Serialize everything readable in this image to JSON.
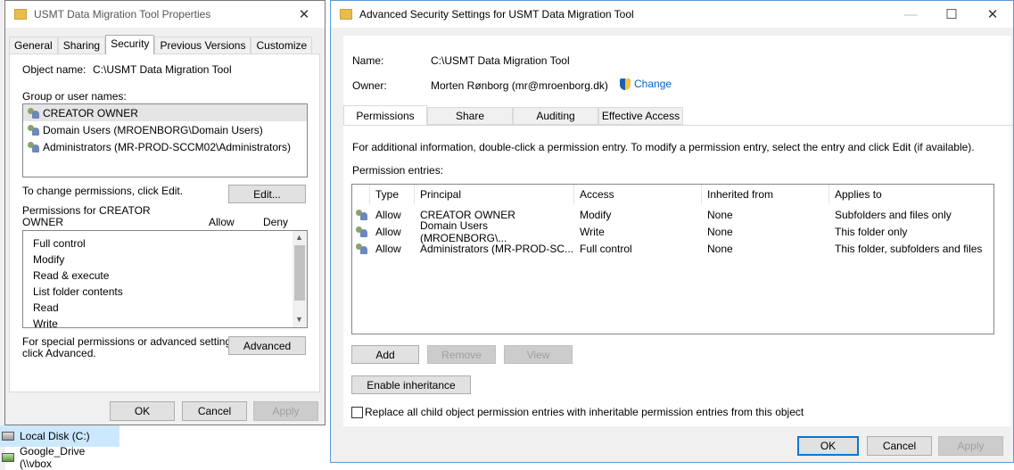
{
  "explorer": {
    "items": [
      {
        "label": "Local Disk (C:)",
        "selected": true
      },
      {
        "label": "Google_Drive (\\\\vbox",
        "selected": false
      }
    ]
  },
  "props": {
    "title": "USMT Data Migration Tool Properties",
    "tabs": [
      "General",
      "Sharing",
      "Security",
      "Previous Versions",
      "Customize"
    ],
    "active_tab": "Security",
    "object_label": "Object name:",
    "object_value": "C:\\USMT Data Migration Tool",
    "group_label": "Group or user names:",
    "groups": [
      "CREATOR OWNER",
      "Domain Users (MROENBORG\\Domain Users)",
      "Administrators (MR-PROD-SCCM02\\Administrators)"
    ],
    "change_text": "To change permissions, click Edit.",
    "edit_button": "Edit...",
    "perm_label_1": "Permissions for CREATOR",
    "perm_label_2": "OWNER",
    "allow_col": "Allow",
    "deny_col": "Deny",
    "permissions": [
      "Full control",
      "Modify",
      "Read & execute",
      "List folder contents",
      "Read",
      "Write"
    ],
    "special_text_1": "For special permissions or advanced settings,",
    "special_text_2": "click Advanced.",
    "advanced_button": "Advanced",
    "ok": "OK",
    "cancel": "Cancel",
    "apply": "Apply"
  },
  "adv": {
    "title": "Advanced Security Settings for USMT Data Migration Tool",
    "name_label": "Name:",
    "name_value": "C:\\USMT Data Migration Tool",
    "owner_label": "Owner:",
    "owner_value": "Morten Rønborg (mr@mroenborg.dk)",
    "change_link": "Change",
    "tabs": [
      "Permissions",
      "Share",
      "Auditing",
      "Effective Access"
    ],
    "info": "For additional information, double-click a permission entry. To modify a permission entry, select the entry and click Edit (if available).",
    "entries_label": "Permission entries:",
    "columns": [
      "Type",
      "Principal",
      "Access",
      "Inherited from",
      "Applies to"
    ],
    "rows": [
      [
        "Allow",
        "CREATOR OWNER",
        "Modify",
        "None",
        "Subfolders and files only"
      ],
      [
        "Allow",
        "Domain Users (MROENBORG\\...",
        "Write",
        "None",
        "This folder only"
      ],
      [
        "Allow",
        "Administrators (MR-PROD-SC...",
        "Full control",
        "None",
        "This folder, subfolders and files"
      ]
    ],
    "add": "Add",
    "remove": "Remove",
    "view": "View",
    "enable_inheritance": "Enable inheritance",
    "replace_text": "Replace all child object permission entries with inheritable permission entries from this object",
    "ok": "OK",
    "cancel": "Cancel",
    "apply": "Apply"
  }
}
